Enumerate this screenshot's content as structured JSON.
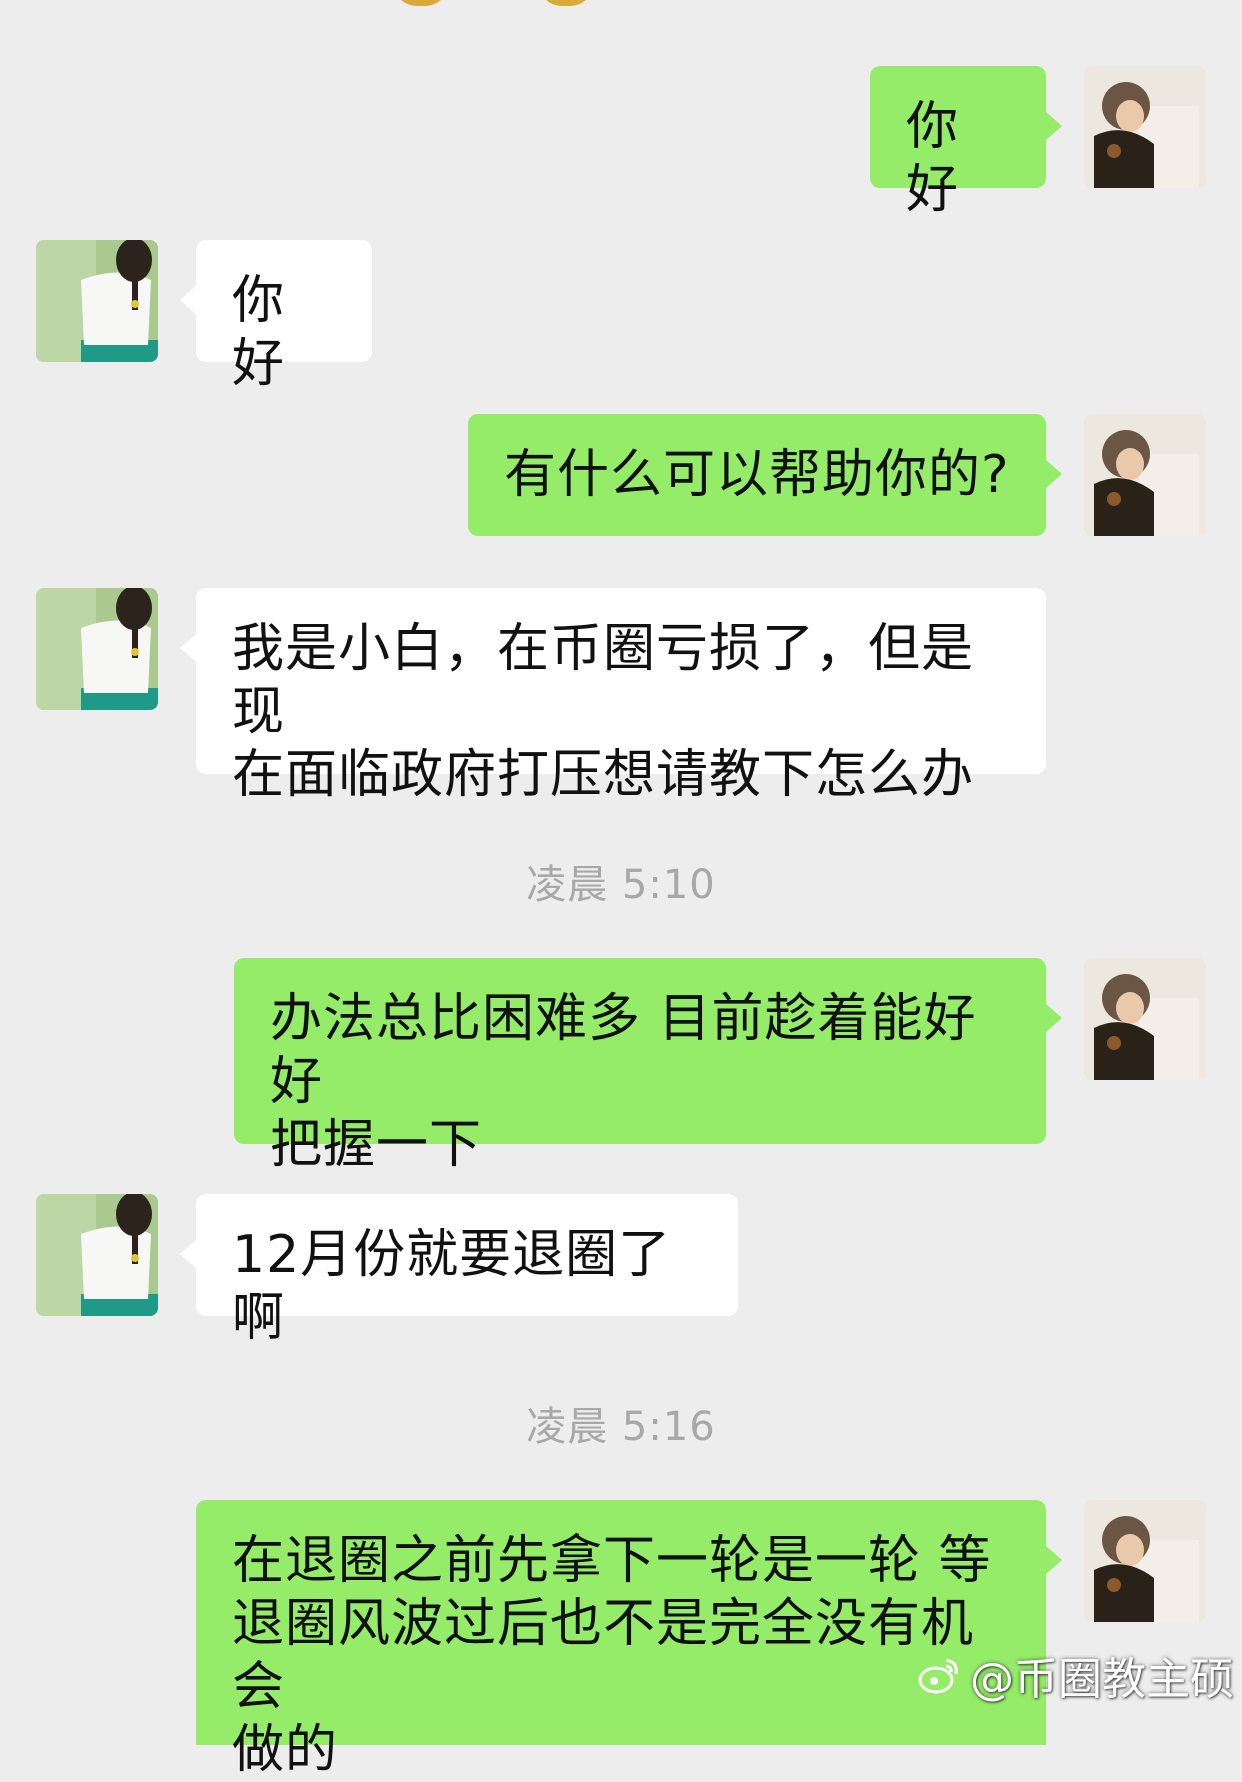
{
  "messages": [
    {
      "side": "out",
      "text": "你好"
    },
    {
      "side": "in",
      "text": "你好"
    },
    {
      "side": "out",
      "text": "有什么可以帮助你的?"
    },
    {
      "side": "in",
      "text": "我是小白，在币圈亏损了，但是现\n在面临政府打压想请教下怎么办"
    },
    {
      "side": "out",
      "text": "办法总比困难多 目前趁着能好好\n把握一下"
    },
    {
      "side": "in",
      "text": "12月份就要退圈了啊"
    },
    {
      "side": "out",
      "text": "在退圈之前先拿下一轮是一轮 等\n退圈风波过后也不是完全没有机会\n做的"
    }
  ],
  "timestamps": [
    "凌晨 5:10",
    "凌晨 5:16"
  ],
  "watermark": {
    "text": "@币圈教主硕",
    "icon": "sina-weibo-logo-icon"
  },
  "colors": {
    "background": "#ededed",
    "outgoing_bubble": "#95ec69",
    "incoming_bubble": "#ffffff",
    "timestamp": "#a8a8a8"
  },
  "avatars": {
    "self": "boy-with-dog-avatar",
    "contact": "girl-with-braid-avatar"
  }
}
